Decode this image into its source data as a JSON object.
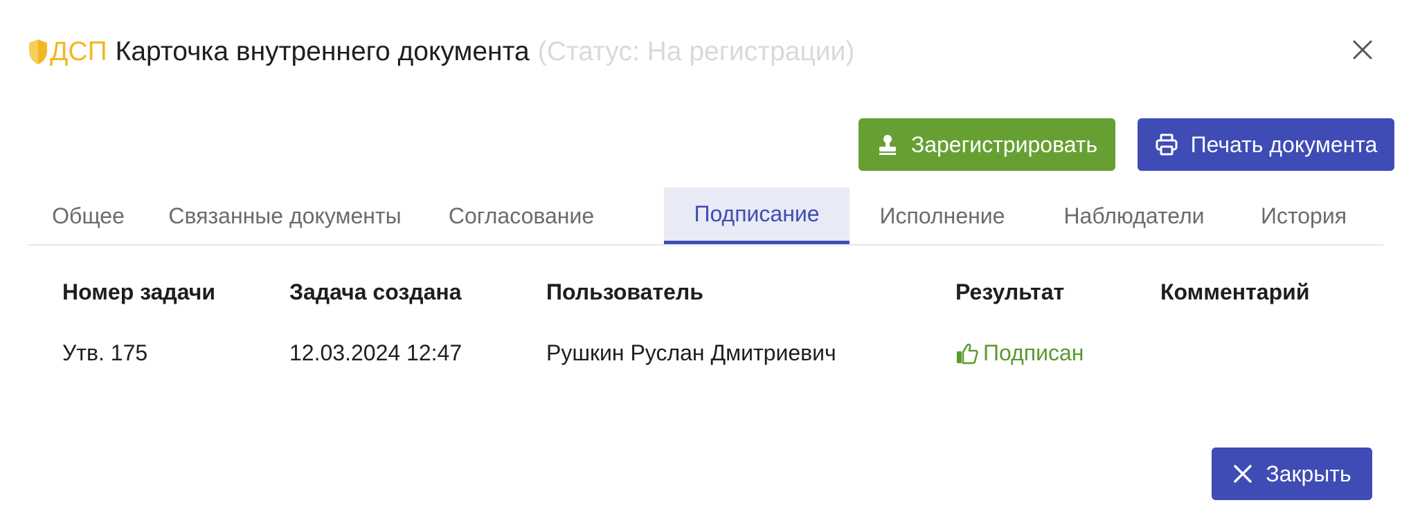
{
  "header": {
    "badge_label": "ДСП",
    "title": "Карточка внутреннего документа",
    "status": "(Статус: На регистрации)"
  },
  "actions": {
    "register_label": "Зарегистрировать",
    "print_label": "Печать документа",
    "close_label": "Закрыть"
  },
  "tabs": [
    {
      "label": "Общее",
      "active": false
    },
    {
      "label": "Связанные документы",
      "active": false
    },
    {
      "label": "Согласование",
      "active": false
    },
    {
      "label": "Подписание",
      "active": true
    },
    {
      "label": "Исполнение",
      "active": false
    },
    {
      "label": "Наблюдатели",
      "active": false
    },
    {
      "label": "История",
      "active": false
    }
  ],
  "table": {
    "columns": [
      "Номер задачи",
      "Задача создана",
      "Пользователь",
      "Результат",
      "Комментарий"
    ],
    "rows": [
      {
        "task_number": "Утв. 175",
        "created": "12.03.2024 12:47",
        "user": "Рушкин Руслан Дмитриевич",
        "result": "Подписан",
        "comment": ""
      }
    ]
  },
  "colors": {
    "accent": "#3f4cb5",
    "success": "#67a032",
    "warning": "#f2b823",
    "status_muted": "#d9d9d9"
  },
  "icons": {
    "badge": "shield-icon",
    "register": "stamp-icon",
    "print": "printer-icon",
    "close_dialog": "close-icon",
    "result": "thumbs-up-icon",
    "close_button": "close-icon"
  }
}
